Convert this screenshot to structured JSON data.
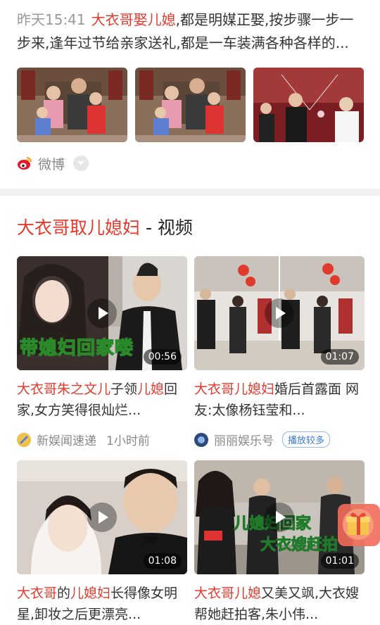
{
  "top": {
    "time": "昨天15:41",
    "highlight": "大衣哥娶儿媳",
    "text": ",都是明媒正娶,按步骤一步一步来,逢年过节给亲家送礼,都是一车装满各种各样的...",
    "source": "微博"
  },
  "section": {
    "title_red": "大衣哥取儿媳妇",
    "title_rest": " - 视频"
  },
  "videos": [
    {
      "duration": "00:56",
      "overlay": "带媳妇回家喽",
      "title_red": "大衣哥朱之文儿",
      "title_mid": "子领",
      "title_red2": "儿媳",
      "title_rest": "回家,女方笑得很灿烂...",
      "source": "新娱闻速递",
      "ago": "1小时前"
    },
    {
      "duration": "01:07",
      "title_red": "大衣哥儿媳妇",
      "title_rest": "婚后首露面 网友:太像杨钰莹和...",
      "source": "丽丽娱乐号",
      "badge": "播放较多"
    },
    {
      "duration": "01:08",
      "title_red": "大衣哥",
      "title_mid": "的",
      "title_red2": "儿媳妇",
      "title_rest": "长得像女明星,卸妆之后更漂亮...",
      "source": ""
    },
    {
      "duration": "01:01",
      "overlay1": "儿媳妇回家",
      "overlay2": "大衣嫂赶拍",
      "title_red": "大衣哥儿媳",
      "title_rest": "又美又飒,大衣嫂帮她赶拍客,朱小伟...",
      "source": ""
    }
  ]
}
